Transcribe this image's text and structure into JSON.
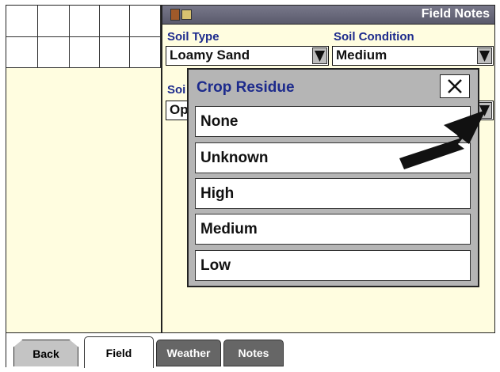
{
  "header": {
    "title": "Field Notes",
    "icon": "notebook-icon"
  },
  "fields": {
    "soil_type": {
      "label": "Soil Type",
      "value": "Loamy Sand"
    },
    "soil_condition": {
      "label": "Soil Condition",
      "value": "Medium"
    },
    "third": {
      "label": "Soi",
      "value": "Op"
    }
  },
  "popup": {
    "title": "Crop Residue",
    "close_icon": "close-icon",
    "options": [
      "None",
      "Unknown",
      "High",
      "Medium",
      "Low"
    ]
  },
  "tabs": {
    "back": "Back",
    "field": "Field",
    "weather": "Weather",
    "notes": "Notes"
  },
  "colors": {
    "panel_bg": "#fffde0",
    "title_bar": "#66667a",
    "label_blue": "#1c2a8c",
    "popup_bg": "#b5b5b5"
  }
}
